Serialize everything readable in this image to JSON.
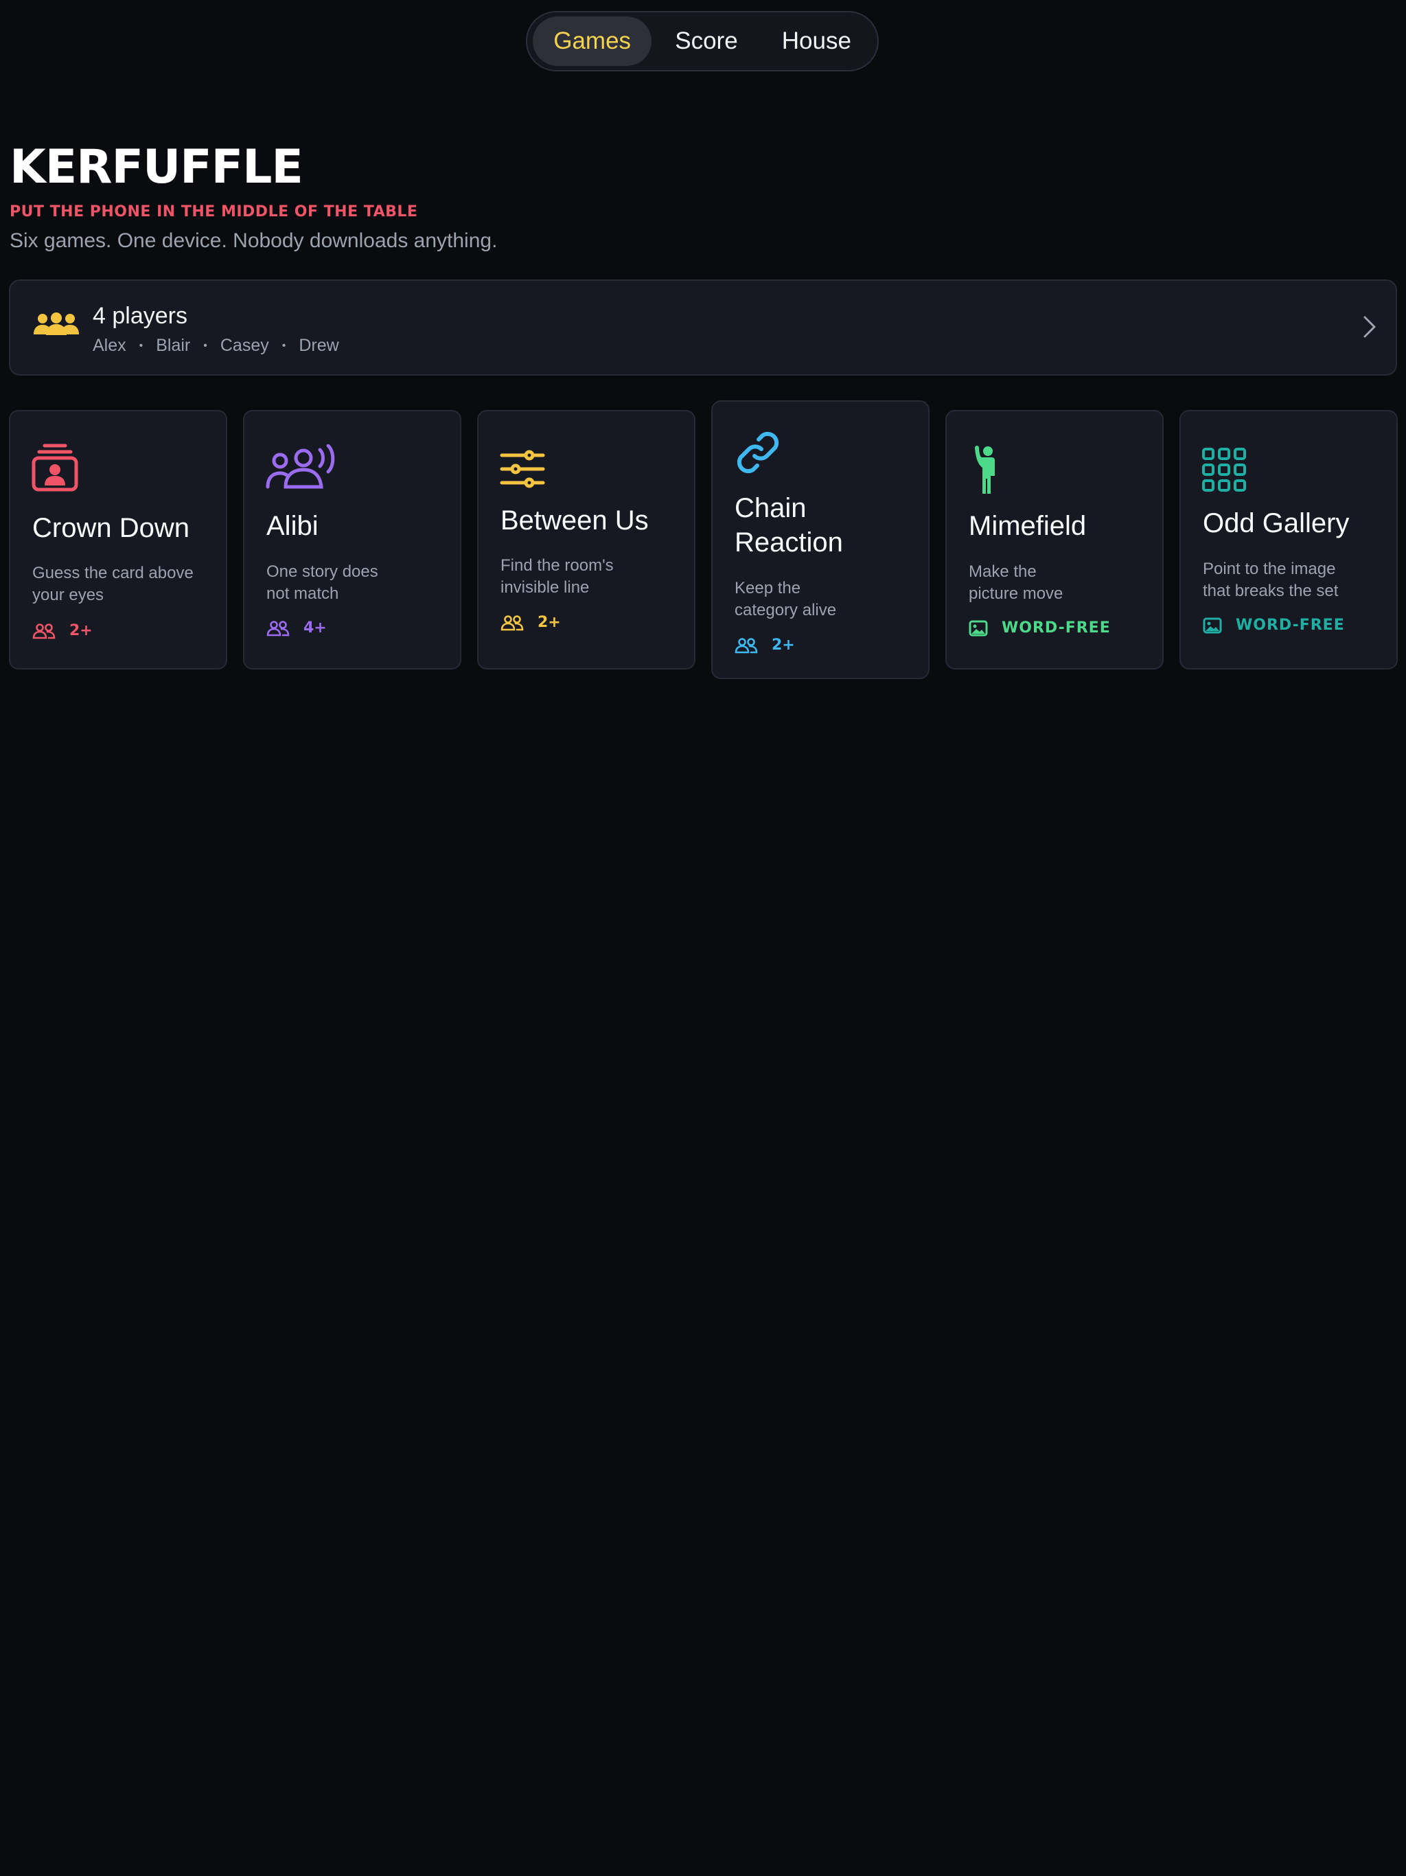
{
  "nav": {
    "tabs": [
      {
        "label": "Games",
        "active": true
      },
      {
        "label": "Score",
        "active": false
      },
      {
        "label": "House",
        "active": false
      }
    ],
    "active_color": "#f5d34f"
  },
  "header": {
    "title": "KERFUFFLE",
    "tagline": "PUT THE PHONE IN THE MIDDLE OF THE TABLE",
    "subtitle": "Six games. One device. Nobody downloads anything."
  },
  "players": {
    "icon": "group-icon",
    "count_label": "4 players",
    "names": [
      "Alex",
      "Blair",
      "Casey",
      "Drew"
    ],
    "separator": "•",
    "chevron_icon": "chevron-right-icon"
  },
  "games": [
    {
      "name": "Crown Down",
      "description": [
        "Guess the card above",
        "your eyes"
      ],
      "icon": "contact-card-icon",
      "meta_icon": "players-icon",
      "meta": "2+",
      "color": "#ef5467"
    },
    {
      "name": "Alibi",
      "description": [
        "One story does",
        "not match"
      ],
      "icon": "speaking-people-icon",
      "meta_icon": "players-icon",
      "meta": "4+",
      "color": "#9b6cf0"
    },
    {
      "name": "Between Us",
      "description": [
        "Find the room's",
        "invisible line"
      ],
      "icon": "sliders-icon",
      "meta_icon": "players-icon",
      "meta": "2+",
      "color": "#f5c542"
    },
    {
      "name": "Chain Reaction",
      "name_lines": [
        "Chain",
        "Reaction"
      ],
      "description": [
        "Keep the",
        "category alive"
      ],
      "icon": "link-icon",
      "meta_icon": "players-icon",
      "meta": "2+",
      "color": "#3fb8f0"
    },
    {
      "name": "Mimefield",
      "description": [
        "Make the",
        "picture move"
      ],
      "icon": "mime-figure-icon",
      "meta_icon": "image-icon",
      "meta": "WORD-FREE",
      "color": "#4cd98a"
    },
    {
      "name": "Odd Gallery",
      "description": [
        "Point to the image",
        "that breaks the set"
      ],
      "icon": "grid-icon",
      "meta_icon": "image-icon",
      "meta": "WORD-FREE",
      "color": "#1fb0a5"
    }
  ]
}
